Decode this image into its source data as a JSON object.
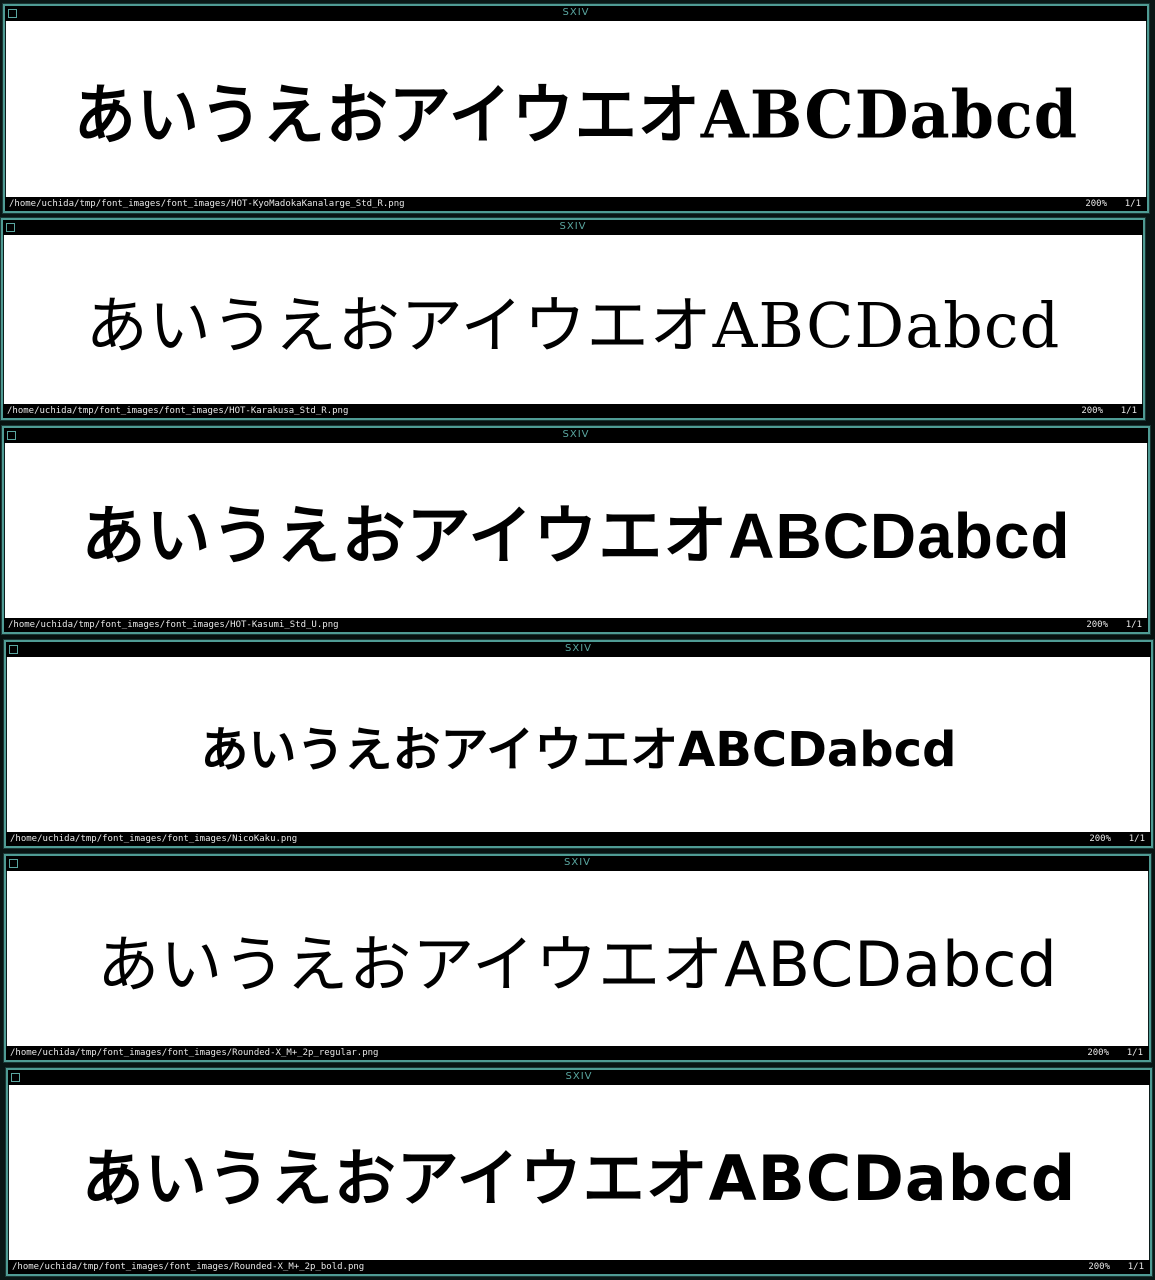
{
  "app_name": "sxiv",
  "sample_text": "あいうえおアイウエオABCDabcd",
  "windows": [
    {
      "title": "SXIV",
      "file_path": "/home/uchida/tmp/font_images/font_images/HOT-KyoMadokaKanalarge_Std_R.png",
      "zoom": "200%",
      "page": "1/1"
    },
    {
      "title": "SXIV",
      "file_path": "/home/uchida/tmp/font_images/font_images/HOT-Karakusa_Std_R.png",
      "zoom": "200%",
      "page": "1/1"
    },
    {
      "title": "SXIV",
      "file_path": "/home/uchida/tmp/font_images/font_images/HOT-Kasumi_Std_U.png",
      "zoom": "200%",
      "page": "1/1"
    },
    {
      "title": "SXIV",
      "file_path": "/home/uchida/tmp/font_images/font_images/NicoKaku.png",
      "zoom": "200%",
      "page": "1/1"
    },
    {
      "title": "SXIV",
      "file_path": "/home/uchida/tmp/font_images/font_images/Rounded-X_M+_2p_regular.png",
      "zoom": "200%",
      "page": "1/1"
    },
    {
      "title": "SXIV",
      "file_path": "/home/uchida/tmp/font_images/font_images/Rounded-X_M+_2p_bold.png",
      "zoom": "200%",
      "page": "1/1"
    }
  ],
  "colors": {
    "border": "#4f9b94",
    "title_text": "#5aa6a0",
    "bar_background": "#000000",
    "status_text": "#e6e6e6",
    "image_background": "#ffffff"
  }
}
